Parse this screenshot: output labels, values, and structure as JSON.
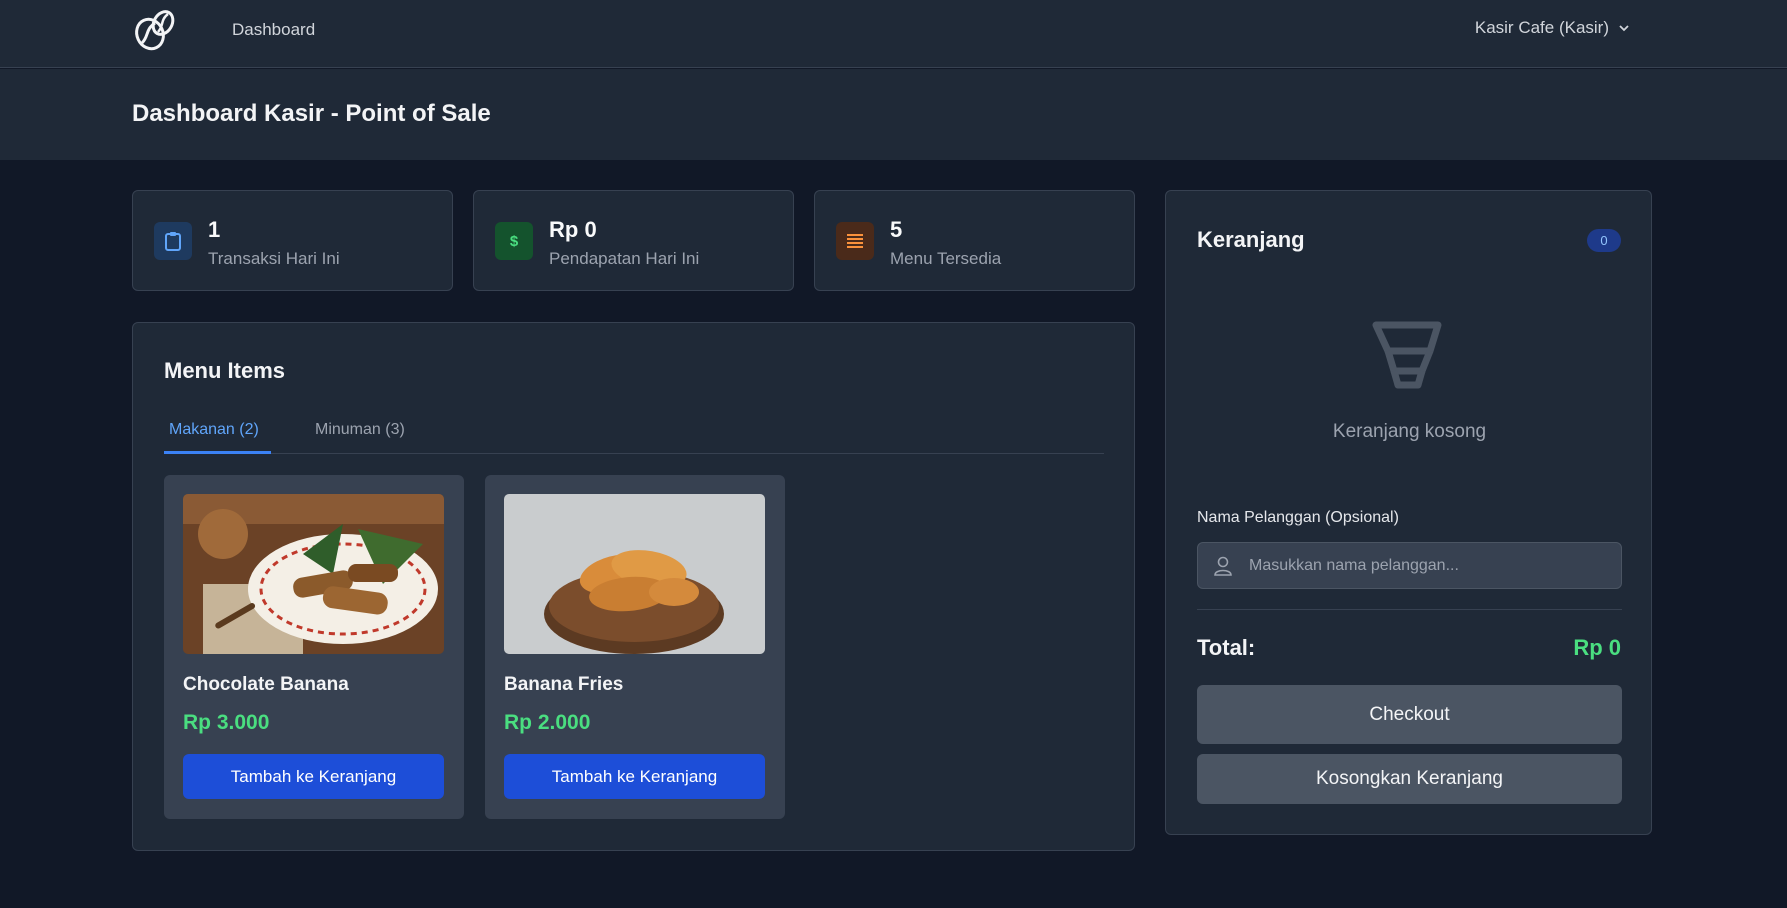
{
  "nav": {
    "logo_icon": "coffee-bean-icon",
    "dashboard_link": "Dashboard",
    "user_label": "Kasir Cafe (Kasir)"
  },
  "page": {
    "title": "Dashboard Kasir - Point of Sale"
  },
  "stats": [
    {
      "value": "1",
      "label": "Transaksi Hari Ini",
      "icon": "clipboard-icon",
      "color": "#60a5fa"
    },
    {
      "value": "Rp 0",
      "label": "Pendapatan Hari Ini",
      "icon": "dollar-icon",
      "color": "#4ade80"
    },
    {
      "value": "5",
      "label": "Menu Tersedia",
      "icon": "list-icon",
      "color": "#fb923c"
    }
  ],
  "menu": {
    "title": "Menu Items",
    "tabs": [
      {
        "label": "Makanan (2)",
        "active": true
      },
      {
        "label": "Minuman (3)",
        "active": false
      }
    ],
    "items": [
      {
        "name": "Chocolate Banana",
        "price": "Rp 3.000",
        "button": "Tambah ke Keranjang"
      },
      {
        "name": "Banana Fries",
        "price": "Rp 2.000",
        "button": "Tambah ke Keranjang"
      }
    ]
  },
  "cart": {
    "title": "Keranjang",
    "count": "0",
    "empty_text": "Keranjang kosong",
    "customer_label": "Nama Pelanggan (Opsional)",
    "customer_placeholder": "Masukkan nama pelanggan...",
    "total_label": "Total:",
    "total_value": "Rp 0",
    "checkout_label": "Checkout",
    "clear_label": "Kosongkan Keranjang"
  },
  "colors": {
    "accent_blue": "#3b82f6",
    "price_green": "#4ade80",
    "button_blue": "#1d4ed8",
    "background": "#111827",
    "card": "#1f2937"
  }
}
